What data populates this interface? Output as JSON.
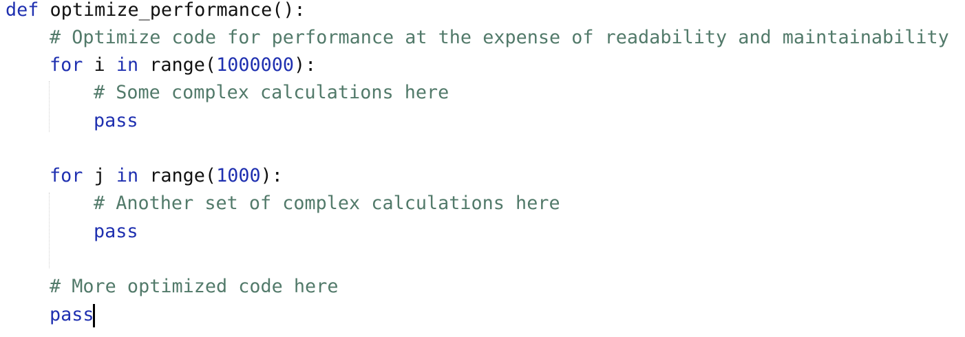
{
  "colors": {
    "keyword": "#1f30b0",
    "number": "#1f30b0",
    "comment": "#527a6a",
    "text": "#111111",
    "background": "#ffffff"
  },
  "code": {
    "line1": {
      "kw": "def",
      "name": "optimize_performance():"
    },
    "line2": {
      "comment": "# Optimize code for performance at the expense of readability and maintainability"
    },
    "line3": {
      "kw_for": "for",
      "var": "i",
      "kw_in": "in",
      "fn": "range(",
      "num": "1000000",
      "close": "):"
    },
    "line4": {
      "comment": "# Some complex calculations here"
    },
    "line5": {
      "kw": "pass"
    },
    "line7": {
      "kw_for": "for",
      "var": "j",
      "kw_in": "in",
      "fn": "range(",
      "num": "1000",
      "close": "):"
    },
    "line8": {
      "comment": "# Another set of complex calculations here"
    },
    "line9": {
      "kw": "pass"
    },
    "line11": {
      "comment": "# More optimized code here"
    },
    "line12": {
      "kw": "pass"
    }
  }
}
